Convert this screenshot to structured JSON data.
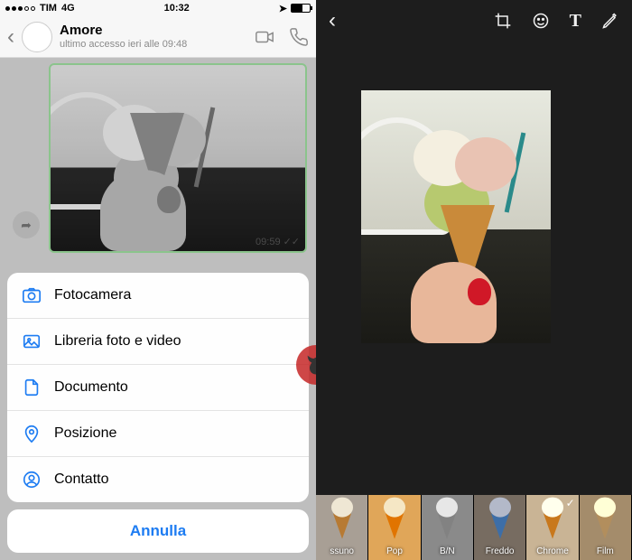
{
  "status_bar": {
    "carrier": "TIM",
    "network": "4G",
    "time": "10:32"
  },
  "chat": {
    "contact_name": "Amore",
    "last_seen": "ultimo accesso ieri alle 09:48",
    "message_time": "09:59"
  },
  "action_sheet": {
    "items": [
      {
        "label": "Fotocamera"
      },
      {
        "label": "Libreria foto e video"
      },
      {
        "label": "Documento"
      },
      {
        "label": "Posizione"
      },
      {
        "label": "Contatto"
      }
    ],
    "cancel": "Annulla"
  },
  "editor": {
    "filters": [
      {
        "key": "nessuno",
        "label": "ssuno",
        "selected": false
      },
      {
        "key": "pop",
        "label": "Pop",
        "selected": false
      },
      {
        "key": "bn",
        "label": "B/N",
        "selected": false
      },
      {
        "key": "freddo",
        "label": "Freddo",
        "selected": false
      },
      {
        "key": "chrome",
        "label": "Chrome",
        "selected": true
      },
      {
        "key": "film",
        "label": "Film",
        "selected": false
      }
    ]
  }
}
